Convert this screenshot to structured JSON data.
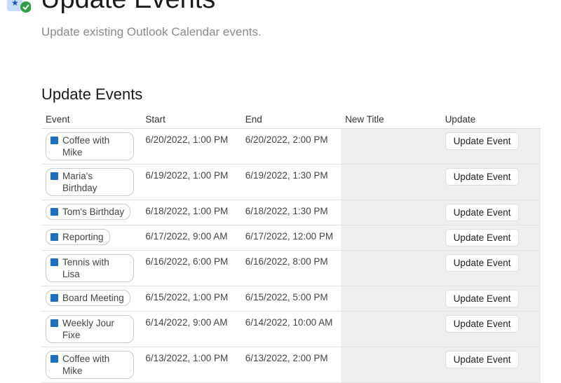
{
  "header": {
    "title": "Update Events",
    "subtitle": "Update existing Outlook Calendar events."
  },
  "section": {
    "title": "Update Events"
  },
  "table": {
    "columns": [
      "Event",
      "Start",
      "End",
      "New Title",
      "Update"
    ],
    "rows": [
      {
        "event": "Coffee with Mike",
        "start": "6/20/2022, 1:00 PM",
        "end": "6/20/2022, 2:00 PM",
        "button": "Update Event"
      },
      {
        "event": "Maria's Birthday",
        "start": "6/19/2022, 1:00 PM",
        "end": "6/19/2022, 1:30 PM",
        "button": "Update Event"
      },
      {
        "event": "Tom's Birthday",
        "start": "6/18/2022, 1:00 PM",
        "end": "6/18/2022, 1:30 PM",
        "button": "Update Event"
      },
      {
        "event": "Reporting",
        "start": "6/17/2022, 9:00 AM",
        "end": "6/17/2022, 12:00 PM",
        "button": "Update Event"
      },
      {
        "event": "Tennis with Lisa",
        "start": "6/16/2022, 6:00 PM",
        "end": "6/16/2022, 8:00 PM",
        "button": "Update Event"
      },
      {
        "event": "Board Meeting",
        "start": "6/15/2022, 1:00 PM",
        "end": "6/15/2022, 5:00 PM",
        "button": "Update Event"
      },
      {
        "event": "Weekly Jour Fixe",
        "start": "6/14/2022, 9:00 AM",
        "end": "6/14/2022, 10:00 AM",
        "button": "Update Event"
      },
      {
        "event": "Coffee with Mike",
        "start": "6/13/2022, 1:00 PM",
        "end": "6/13/2022, 2:00 PM",
        "button": "Update Event"
      }
    ]
  }
}
